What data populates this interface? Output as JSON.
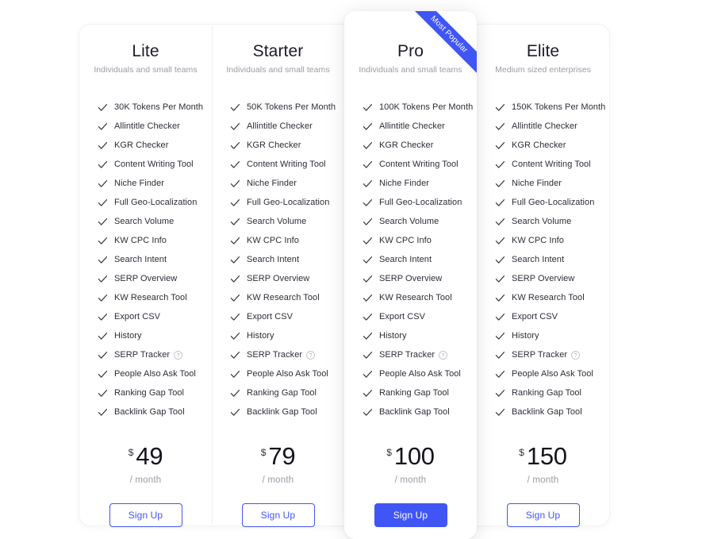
{
  "colors": {
    "accent": "#4055f5",
    "text_primary": "#1c1c26",
    "text_muted": "#9a9aa6",
    "card_bg": "#ffffff",
    "divider": "#f0f0f3",
    "page_bg": "#ffffff"
  },
  "ribbon": {
    "label": "Most Popular"
  },
  "icons": {
    "check": "check-icon",
    "help": "help-circle-icon"
  },
  "plans": [
    {
      "name": "Lite",
      "subtitle": "Individuals and small teams",
      "featured": false,
      "features": [
        {
          "label": "30K Tokens Per Month",
          "help": false
        },
        {
          "label": "Allintitle Checker",
          "help": false
        },
        {
          "label": "KGR Checker",
          "help": false
        },
        {
          "label": "Content Writing Tool",
          "help": false
        },
        {
          "label": "Niche Finder",
          "help": false
        },
        {
          "label": "Full Geo-Localization",
          "help": false
        },
        {
          "label": "Search Volume",
          "help": false
        },
        {
          "label": "KW CPC Info",
          "help": false
        },
        {
          "label": "Search Intent",
          "help": false
        },
        {
          "label": "SERP Overview",
          "help": false
        },
        {
          "label": "KW Research Tool",
          "help": false
        },
        {
          "label": "Export CSV",
          "help": false
        },
        {
          "label": "History",
          "help": false
        },
        {
          "label": "SERP Tracker",
          "help": true
        },
        {
          "label": "People Also Ask Tool",
          "help": false
        },
        {
          "label": "Ranking Gap Tool",
          "help": false
        },
        {
          "label": "Backlink Gap Tool",
          "help": false
        }
      ],
      "currency": "$",
      "price": "49",
      "period": "/ month",
      "cta_label": "Sign Up"
    },
    {
      "name": "Starter",
      "subtitle": "Individuals and small teams",
      "featured": false,
      "features": [
        {
          "label": "50K Tokens Per Month",
          "help": false
        },
        {
          "label": "Allintitle Checker",
          "help": false
        },
        {
          "label": "KGR Checker",
          "help": false
        },
        {
          "label": "Content Writing Tool",
          "help": false
        },
        {
          "label": "Niche Finder",
          "help": false
        },
        {
          "label": "Full Geo-Localization",
          "help": false
        },
        {
          "label": "Search Volume",
          "help": false
        },
        {
          "label": "KW CPC Info",
          "help": false
        },
        {
          "label": "Search Intent",
          "help": false
        },
        {
          "label": "SERP Overview",
          "help": false
        },
        {
          "label": "KW Research Tool",
          "help": false
        },
        {
          "label": "Export CSV",
          "help": false
        },
        {
          "label": "History",
          "help": false
        },
        {
          "label": "SERP Tracker",
          "help": true
        },
        {
          "label": "People Also Ask Tool",
          "help": false
        },
        {
          "label": "Ranking Gap Tool",
          "help": false
        },
        {
          "label": "Backlink Gap Tool",
          "help": false
        }
      ],
      "currency": "$",
      "price": "79",
      "period": "/ month",
      "cta_label": "Sign Up"
    },
    {
      "name": "Pro",
      "subtitle": "Individuals and small teams",
      "featured": true,
      "features": [
        {
          "label": "100K Tokens Per Month",
          "help": false
        },
        {
          "label": "Allintitle Checker",
          "help": false
        },
        {
          "label": "KGR Checker",
          "help": false
        },
        {
          "label": "Content Writing Tool",
          "help": false
        },
        {
          "label": "Niche Finder",
          "help": false
        },
        {
          "label": "Full Geo-Localization",
          "help": false
        },
        {
          "label": "Search Volume",
          "help": false
        },
        {
          "label": "KW CPC Info",
          "help": false
        },
        {
          "label": "Search Intent",
          "help": false
        },
        {
          "label": "SERP Overview",
          "help": false
        },
        {
          "label": "KW Research Tool",
          "help": false
        },
        {
          "label": "Export CSV",
          "help": false
        },
        {
          "label": "History",
          "help": false
        },
        {
          "label": "SERP Tracker",
          "help": true
        },
        {
          "label": "People Also Ask Tool",
          "help": false
        },
        {
          "label": "Ranking Gap Tool",
          "help": false
        },
        {
          "label": "Backlink Gap Tool",
          "help": false
        }
      ],
      "currency": "$",
      "price": "100",
      "period": "/ month",
      "cta_label": "Sign Up"
    },
    {
      "name": "Elite",
      "subtitle": "Medium sized enterprises",
      "featured": false,
      "features": [
        {
          "label": "150K Tokens Per Month",
          "help": false
        },
        {
          "label": "Allintitle Checker",
          "help": false
        },
        {
          "label": "KGR Checker",
          "help": false
        },
        {
          "label": "Content Writing Tool",
          "help": false
        },
        {
          "label": "Niche Finder",
          "help": false
        },
        {
          "label": "Full Geo-Localization",
          "help": false
        },
        {
          "label": "Search Volume",
          "help": false
        },
        {
          "label": "KW CPC Info",
          "help": false
        },
        {
          "label": "Search Intent",
          "help": false
        },
        {
          "label": "SERP Overview",
          "help": false
        },
        {
          "label": "KW Research Tool",
          "help": false
        },
        {
          "label": "Export CSV",
          "help": false
        },
        {
          "label": "History",
          "help": false
        },
        {
          "label": "SERP Tracker",
          "help": true
        },
        {
          "label": "People Also Ask Tool",
          "help": false
        },
        {
          "label": "Ranking Gap Tool",
          "help": false
        },
        {
          "label": "Backlink Gap Tool",
          "help": false
        }
      ],
      "currency": "$",
      "price": "150",
      "period": "/ month",
      "cta_label": "Sign Up"
    }
  ]
}
